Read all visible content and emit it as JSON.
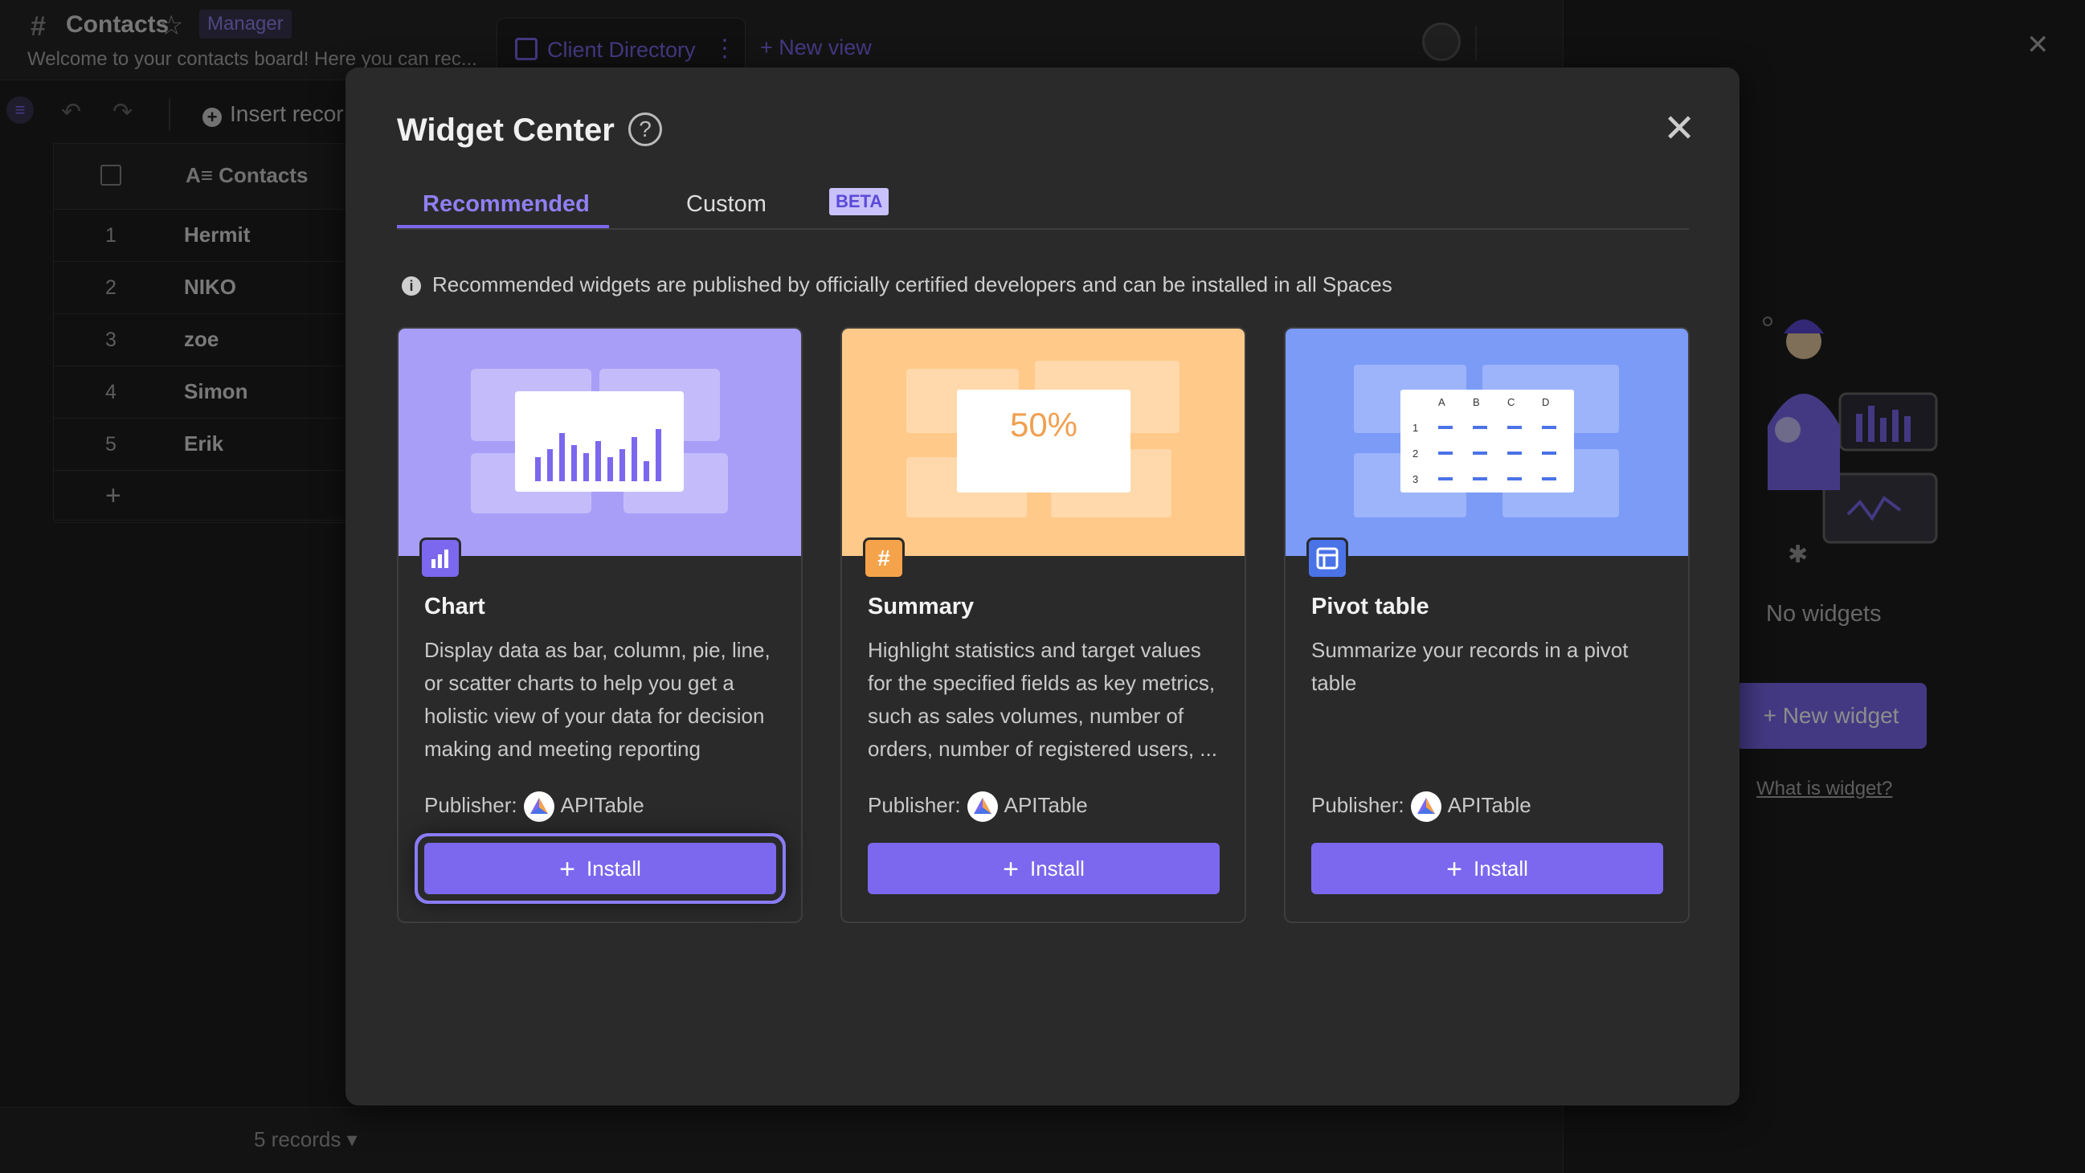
{
  "header": {
    "title": "Contacts",
    "role_badge": "Manager",
    "description": "Welcome to your contacts board! Here you can rec...",
    "view_tab": "Client Directory",
    "new_view": "New view"
  },
  "toolbar": {
    "insert_label": "Insert recor"
  },
  "grid": {
    "column": "Contacts",
    "rows": [
      {
        "num": "1",
        "value": "Hermit"
      },
      {
        "num": "2",
        "value": "NIKO"
      },
      {
        "num": "3",
        "value": "zoe"
      },
      {
        "num": "4",
        "value": "Simon"
      },
      {
        "num": "5",
        "value": "Erik"
      }
    ],
    "add": "+"
  },
  "footer": {
    "records": "5 records ▾"
  },
  "widget_panel": {
    "empty_text": "No widgets",
    "new_widget": "+ New widget",
    "what_link": "What is widget?"
  },
  "modal": {
    "title": "Widget Center",
    "help_icon": "?",
    "tabs": {
      "recommended": "Recommended",
      "custom": "Custom",
      "beta": "BETA"
    },
    "notice": "Recommended widgets are published by officially certified developers and can be installed in all Spaces",
    "publisher_label": "Publisher:",
    "install_label": "Install",
    "cards": [
      {
        "name": "Chart",
        "desc": "Display data as bar, column, pie, line, or scatter charts to help you get a holistic view of your data for decision making and meeting reporting",
        "publisher": "APITable",
        "hero_color": "#a99ef7",
        "icon_color": "#7b68ee",
        "icon_name": "bar-chart-icon"
      },
      {
        "name": "Summary",
        "desc": "Highlight statistics and target values for the specified fields as key metrics, such as sales volumes, number of orders, number of registered users, ...",
        "publisher": "APITable",
        "hero_color": "#ffc98a",
        "icon_color": "#f5a34a",
        "icon_name": "hash-icon",
        "hero_text": "50%"
      },
      {
        "name": "Pivot table",
        "desc": "Summarize your records in a pivot table",
        "publisher": "APITable",
        "hero_color": "#7b9bf7",
        "icon_color": "#4a73e8",
        "icon_name": "pivot-table-icon",
        "hero_cols": [
          "A",
          "B",
          "C",
          "D"
        ],
        "hero_rows": [
          "1",
          "2",
          "3"
        ]
      }
    ]
  }
}
